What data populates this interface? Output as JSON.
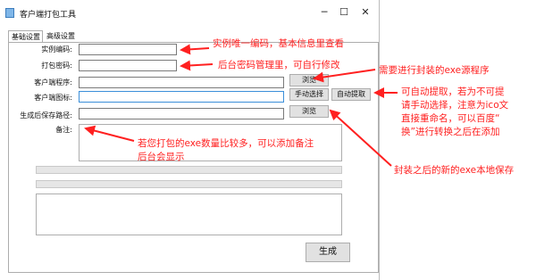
{
  "window": {
    "title": "客户端打包工具",
    "min": "─",
    "max": "☐",
    "close": "✕"
  },
  "tabs": [
    {
      "label": "基础设置"
    },
    {
      "label": "高级设置"
    }
  ],
  "form": {
    "instance_code_label": "实例编码:",
    "pack_password_label": "打包密码:",
    "client_program_label": "客户端程序:",
    "client_icon_label": "客户端图标:",
    "save_path_label": "生成后保存路径:",
    "remark_label": "备注:"
  },
  "buttons": {
    "browse_program": "浏览",
    "manual_select": "手动选择",
    "auto_extract": "自动提取",
    "browse_path": "浏览",
    "generate": "生成"
  },
  "annotations": {
    "instance_code_note": "实例唯一编码，基本信息里查看",
    "password_note": "后台密码管理里，可自行修改",
    "program_note": "需要进行封装的exe源程序",
    "icon_note_1": "可自动提取，若为不可提",
    "icon_note_2": "请手动选择，注意为ico文",
    "icon_note_3": "直接重命名，可以百度“",
    "icon_note_4": "换”进行转换之后在添加",
    "remark_note_1": "若您打包的exe数量比较多，可以添加备注",
    "remark_note_2": "后台会显示",
    "save_path_note": "封装之后的新的exe本地保存"
  },
  "colors": {
    "annotation": "#ff2020",
    "focus_border": "#3b8fd9"
  }
}
